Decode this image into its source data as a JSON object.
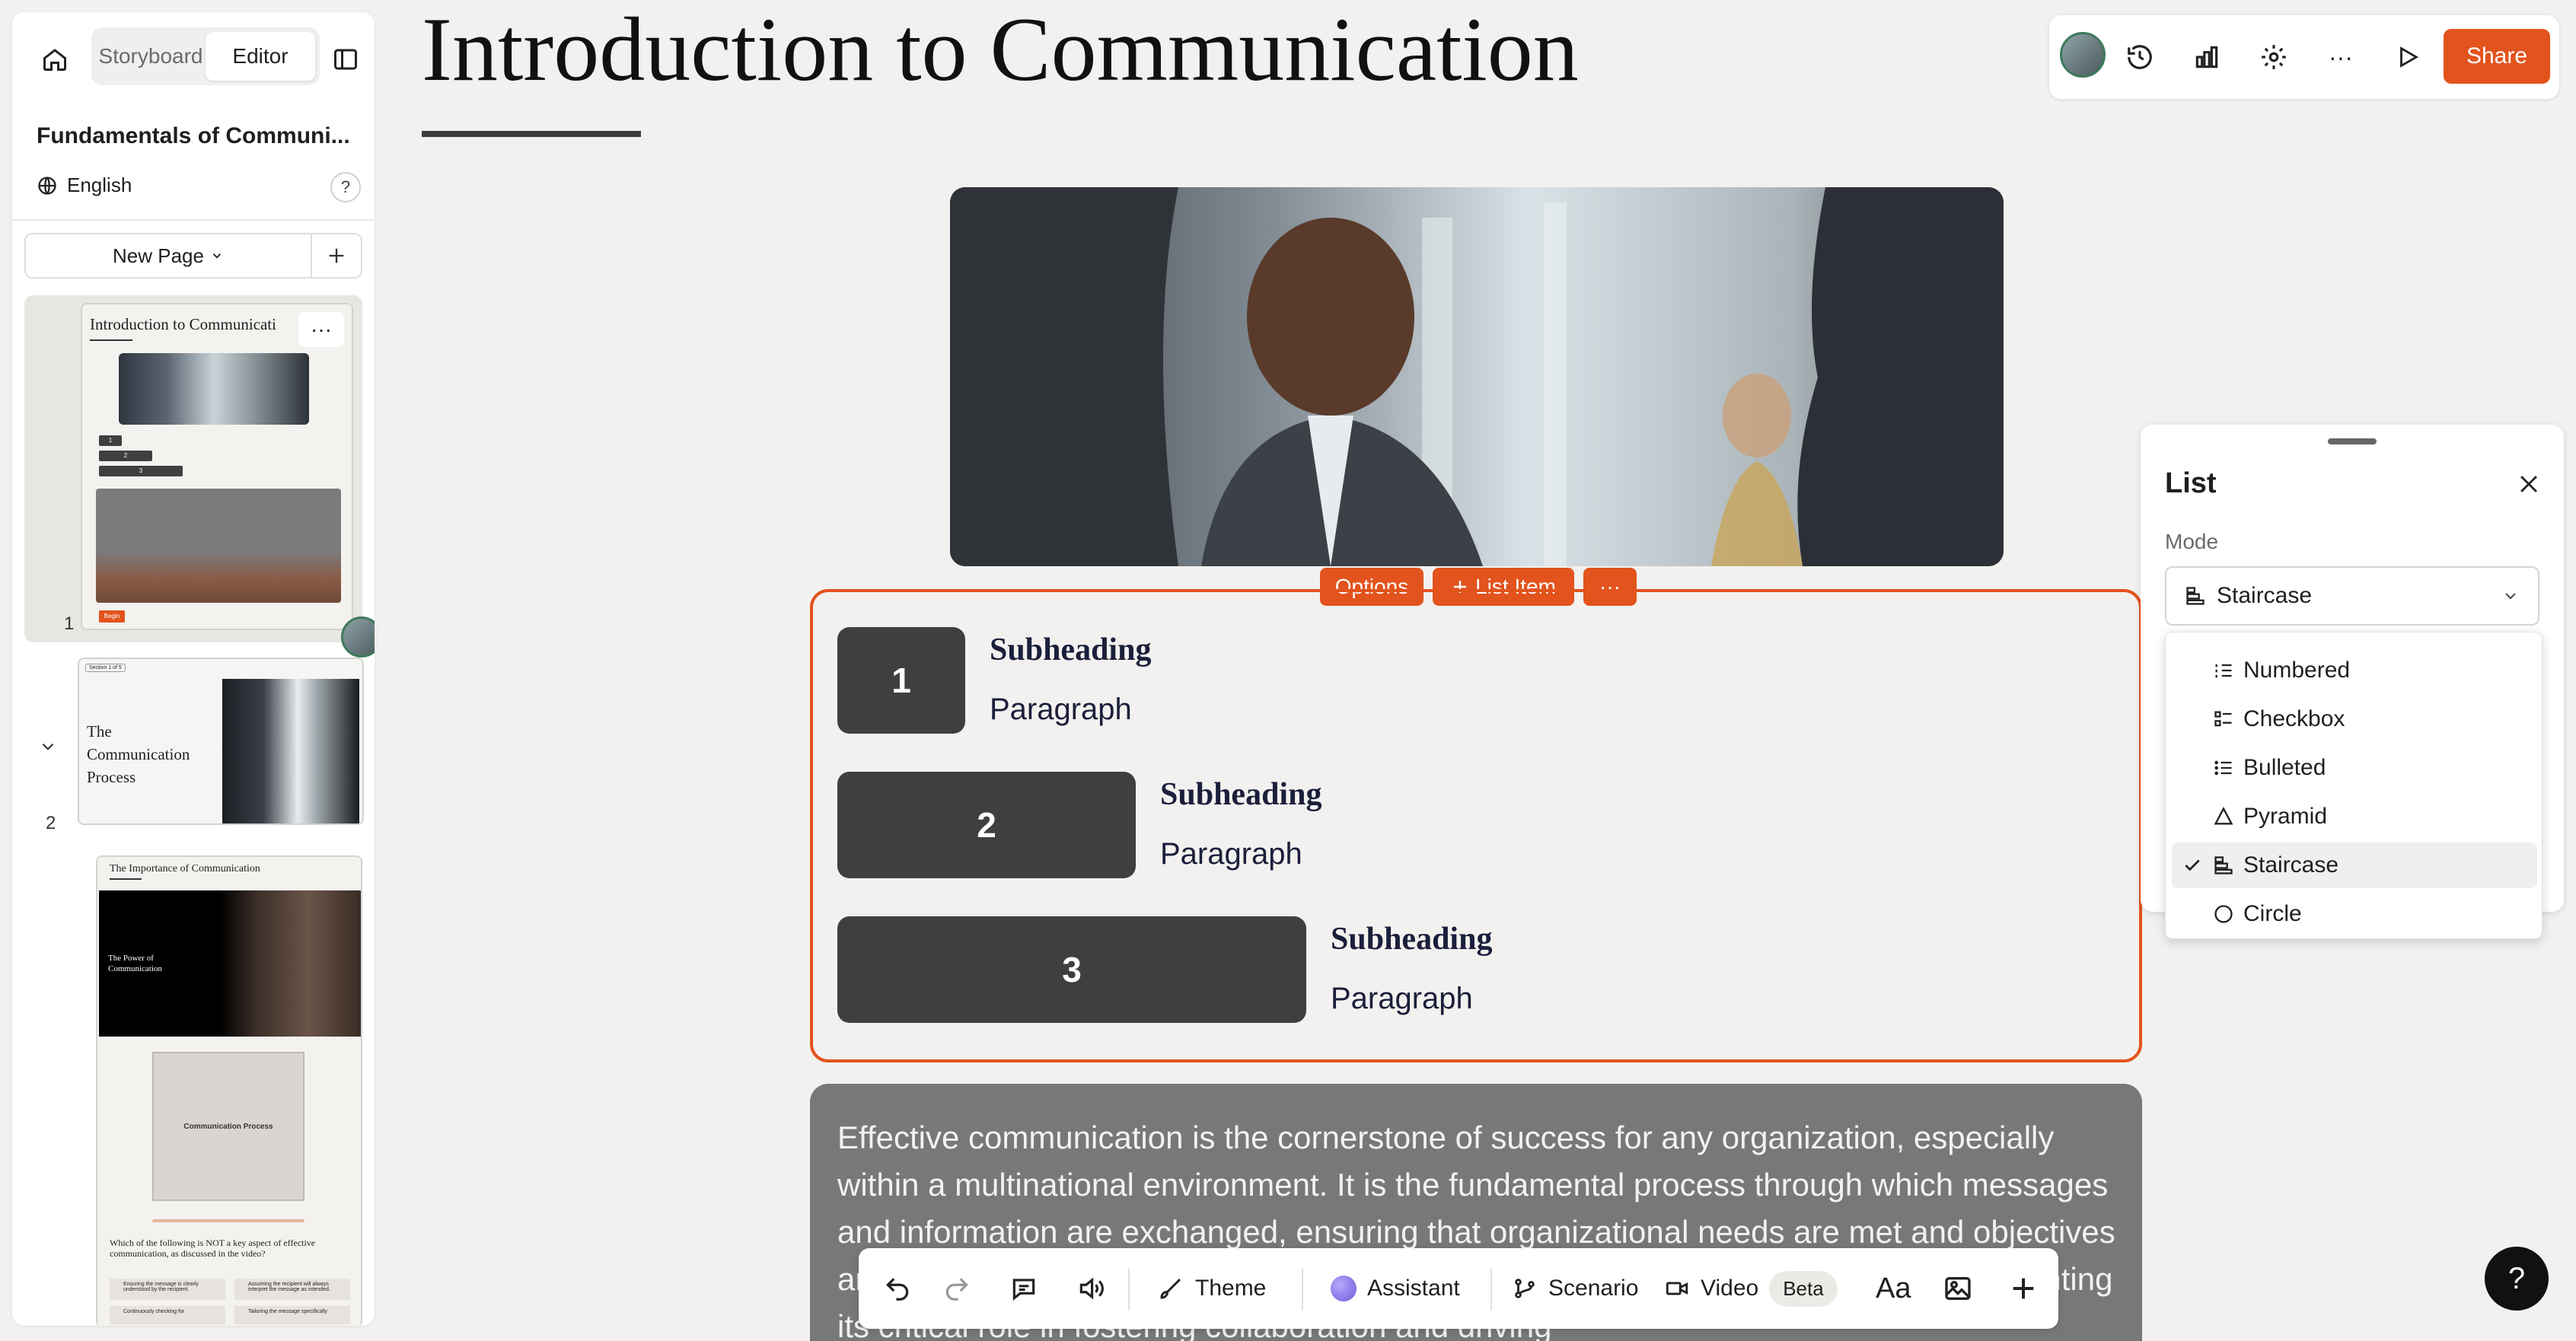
{
  "sidebar": {
    "tabs": [
      {
        "label": "Storyboard"
      },
      {
        "label": "Editor"
      }
    ],
    "course_title": "Fundamentals of Communi...",
    "language": "English",
    "help_label": "?",
    "new_page_label": "New Page",
    "pages": [
      {
        "number": "1",
        "thumb_title": "Introduction to Communicati",
        "thumb_badges": [
          "1",
          "2",
          "3"
        ],
        "thumb_button": "Begin"
      },
      {
        "number": "2",
        "thumb_badge": "Section 1 of 5",
        "thumb_title": "The Communication Process"
      },
      {
        "number": "",
        "thumb_title": "The Importance of Communication",
        "video_title": "The Power of Communication",
        "diagram_label": "Communication Process",
        "question": "Which of the following is NOT a key aspect of effective communication, as discussed in the video?",
        "answers": [
          "Ensuring the message is clearly understood by the recipient.",
          "Assuming the recipient will always interpret the message as intended.",
          "Continuously checking for",
          "Tailoring the message specifically"
        ]
      }
    ]
  },
  "main": {
    "title": "Introduction to Communication",
    "block_toolbar": {
      "options": "Options",
      "list_item": "List Item",
      "more": "···"
    },
    "list_items": [
      {
        "number": "1",
        "subheading": "Subheading",
        "paragraph": "Paragraph"
      },
      {
        "number": "2",
        "subheading": "Subheading",
        "paragraph": "Paragraph"
      },
      {
        "number": "3",
        "subheading": "Subheading",
        "paragraph": "Paragraph"
      }
    ],
    "text_block": "Effective communication is the cornerstone of success for any organization, especially within a multinational environment. It is the fundamental process through which messages and information are exchanged, ensuring that organizational needs are met and objectives are achieved. This lesson will explore the essential aspects of communication, highlighting its critical role in fostering collaboration and driving"
  },
  "topbar": {
    "share_label": "Share"
  },
  "bottombar": {
    "theme": "Theme",
    "assistant": "Assistant",
    "scenario": "Scenario",
    "video": "Video",
    "beta": "Beta",
    "font": "Aa"
  },
  "panel": {
    "title": "List",
    "mode_label": "Mode",
    "selected_mode": "Staircase",
    "modes": [
      {
        "label": "Numbered",
        "icon": "numbered-list-icon"
      },
      {
        "label": "Checkbox",
        "icon": "checkbox-list-icon"
      },
      {
        "label": "Bulleted",
        "icon": "bulleted-list-icon"
      },
      {
        "label": "Pyramid",
        "icon": "pyramid-icon"
      },
      {
        "label": "Staircase",
        "icon": "staircase-icon"
      },
      {
        "label": "Circle",
        "icon": "circle-icon"
      }
    ]
  },
  "help_fab": "?",
  "colors": {
    "accent": "#e2531d",
    "dark_box": "#3f3f3f",
    "text_block_bg": "#787878",
    "heading_navy": "#1b1f3b"
  }
}
